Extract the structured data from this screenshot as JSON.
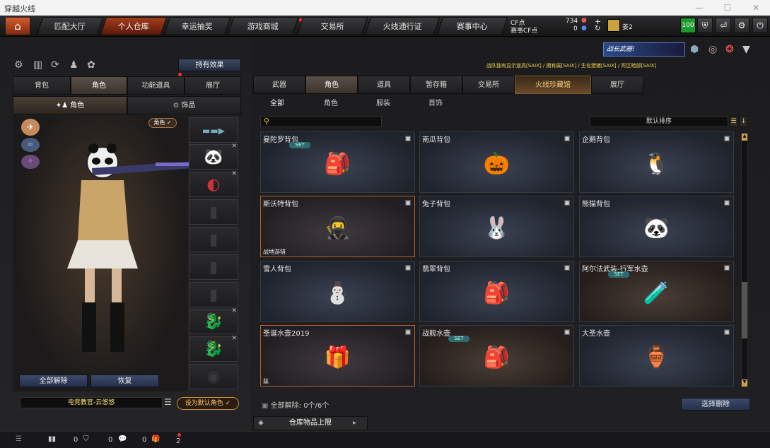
{
  "window": {
    "title": "穿越火线"
  },
  "nav": {
    "tabs": [
      "匹配大厅",
      "个人仓库",
      "幸运抽奖",
      "游戏商城",
      "交易所",
      "火线通行证",
      "赛事中心"
    ],
    "cf_label": "CF点",
    "cf_value": "734",
    "match_cf_label": "赛事CF点",
    "match_cf_value": "0",
    "user_name": "姜2",
    "level": "100"
  },
  "left": {
    "effect_btn": "持有效果",
    "tabs": [
      "背包",
      "角色",
      "功能道具",
      "展厅"
    ],
    "subtabs": [
      "角色",
      "饰品"
    ],
    "role_tag": "角色",
    "unequip_all": "全部解除",
    "restore": "恢复",
    "char_name": "电竞教官-云悠悠",
    "set_default": "设为默认角色"
  },
  "right": {
    "banner": "战长武器!",
    "marquee": "战队独有显示道具[SAIX] / 拥有属[SAIX] / 生化猎猪[SAIX] / 死区暗部[SAIX]",
    "tabs": [
      "武器",
      "角色",
      "道具",
      "暂存箱",
      "交易所",
      "火线珍藏馆",
      "展厅"
    ],
    "subtabs": [
      "全部",
      "角色",
      "服装",
      "首饰"
    ],
    "sort": "默认排序",
    "items": [
      {
        "name": "曼陀罗背包",
        "set": "SET",
        "icon": "🎒",
        "tag": ""
      },
      {
        "name": "南瓜背包",
        "set": "",
        "icon": "🎃",
        "tag": ""
      },
      {
        "name": "企鹅背包",
        "set": "",
        "icon": "🐧",
        "tag": ""
      },
      {
        "name": "斯沃特背包",
        "set": "",
        "icon": "🥷",
        "tag": "战地游猎"
      },
      {
        "name": "兔子背包",
        "set": "",
        "icon": "🐰",
        "tag": ""
      },
      {
        "name": "熊猫背包",
        "set": "",
        "icon": "🐼",
        "tag": ""
      },
      {
        "name": "雪人背包",
        "set": "",
        "icon": "⛄",
        "tag": ""
      },
      {
        "name": "翡翠背包",
        "set": "",
        "icon": "🎒",
        "tag": ""
      },
      {
        "name": "阿尔法武装-行军水壶",
        "set": "SET",
        "icon": "🧪",
        "tag": ""
      },
      {
        "name": "圣诞水壶2019",
        "set": "",
        "icon": "🎁",
        "tag": "兹"
      },
      {
        "name": "战舰水壶",
        "set": "SET",
        "icon": "🎒",
        "tag": ""
      },
      {
        "name": "大圣水壶",
        "set": "",
        "icon": "🏺",
        "tag": ""
      }
    ],
    "unequip_count_label": "全部解除: 0个/6个",
    "select_delete": "选择删除",
    "capacity": "仓库物品上限"
  },
  "bottom": {
    "v1": "0",
    "v2": "0",
    "v3": "0",
    "v4": "2"
  },
  "colors": {
    "accent": "#a33d1d",
    "gold": "#ffd27a",
    "card_border_orange": "#b4622a"
  }
}
